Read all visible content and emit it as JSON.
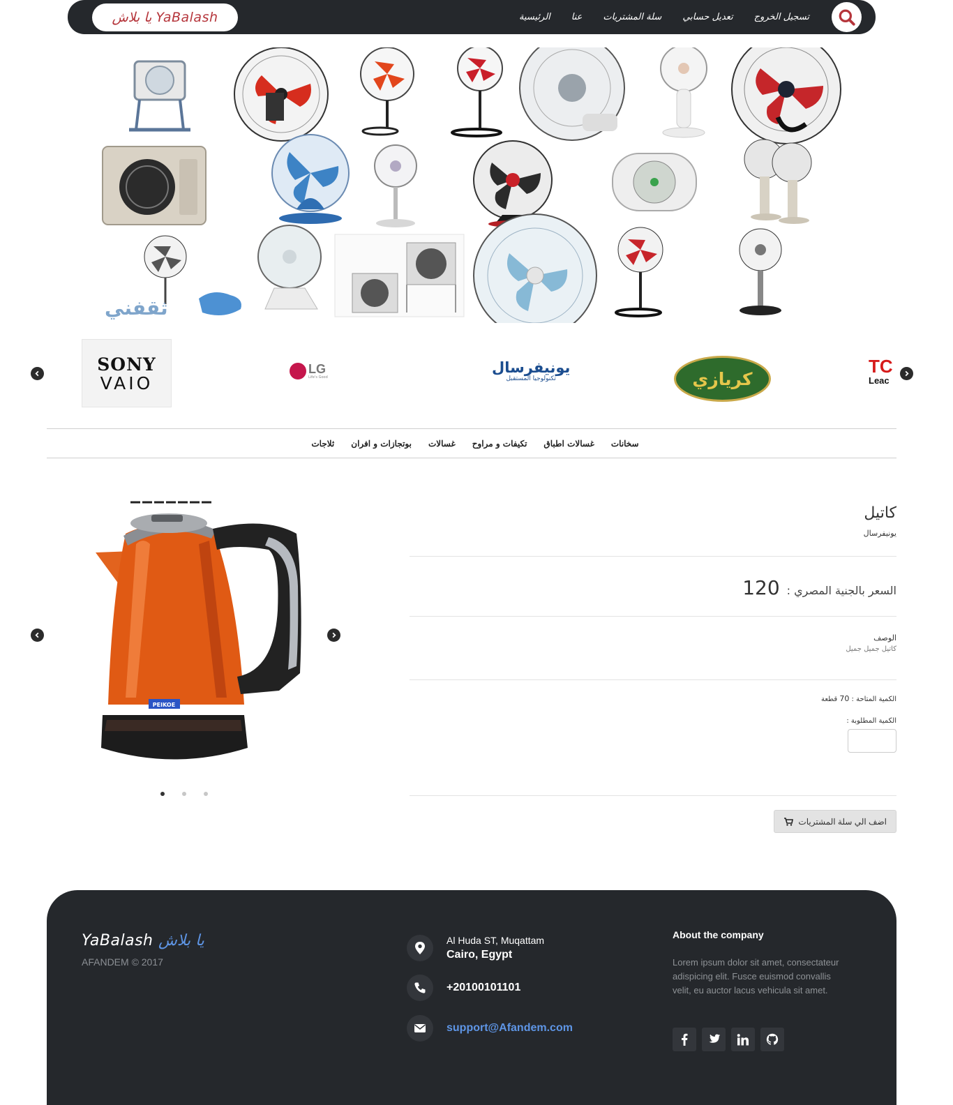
{
  "navbar": {
    "brand": "يا بلاش YaBalash",
    "links": [
      "تسجيل الخروج",
      "تعديل حسابي",
      "سلة المشتريات",
      "عنا",
      "الرئيسية"
    ],
    "search_icon": "search-icon",
    "bg_color": "#25282c"
  },
  "brands": {
    "sony_top": "SONY",
    "sony_bottom": "VAIO",
    "lg": "LG",
    "lg_tagline": "Life's Good",
    "univ_title": "يونيفرسال",
    "univ_sub": "تكنولوجيا المستقبل",
    "kiriazi": "كريازي",
    "tcl_top": "TC",
    "tcl_bottom": "Leac"
  },
  "categories": [
    "سخانات",
    "غسالات اطباق",
    "تكيفات و مراوح",
    "غسالات",
    "بوتجازات و افران",
    "ثلاجات"
  ],
  "product": {
    "title": "كاتيل",
    "brand": "يونيفرسال",
    "price_label": "السعر بالجنية المصري :",
    "price": "120",
    "description_label": "الوصف",
    "description": "كاتيل جميل جميل",
    "available_label": "الكمية المتاحة :",
    "available_value": "70",
    "available_unit": "قطعة",
    "requested_label": "الكمية المطلوبة :",
    "add_to_cart": "اضف الي سلة المشتريات",
    "kettle_label": "PEIKOE",
    "slides": 3,
    "active_slide": 1
  },
  "footer": {
    "logo_en": "YaBalash",
    "logo_ar": "يا بلاش",
    "copyright": "AFANDEM © 2017",
    "address_line1": "Al Huda ST, Muqattam",
    "address_line2": "Cairo, Egypt",
    "phone": "+20100101101",
    "email": "support@Afandem.com",
    "about_title": "About the company",
    "about_text": "Lorem ipsum dolor sit amet, consectateur adispicing elit. Fusce euismod convallis velit, eu auctor lacus vehicula sit amet.",
    "socials": [
      "facebook-icon",
      "twitter-icon",
      "linkedin-icon",
      "github-icon"
    ],
    "accent": "#5e95e5"
  },
  "collage_watermark": "ثقفني"
}
